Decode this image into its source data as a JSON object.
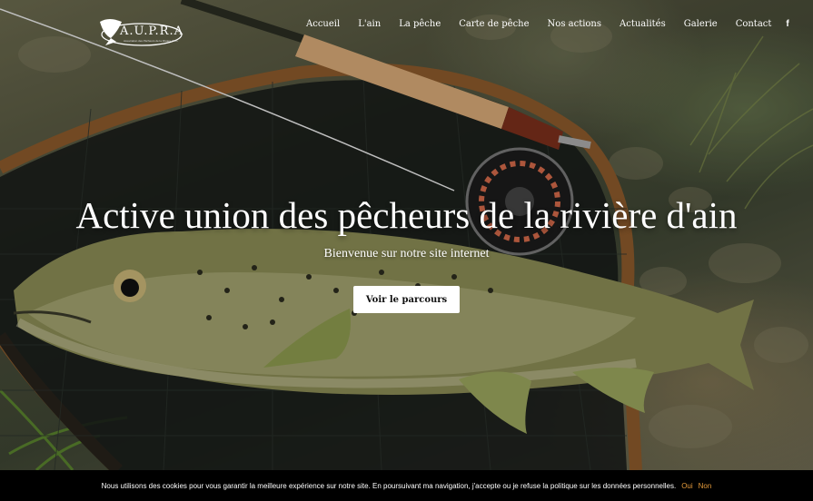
{
  "brand": {
    "logo_text": "A.U.P.R.A",
    "logo_subtext": "Association des Pêcheurs de la Rivière d'Ain"
  },
  "nav": {
    "items": [
      "Accueil",
      "L'ain",
      "La pêche",
      "Carte de pêche",
      "Nos actions",
      "Actualités",
      "Galerie",
      "Contact"
    ],
    "facebook": "f"
  },
  "hero": {
    "title": "Active union des pêcheurs de la rivière d'ain",
    "subtitle": "Bienvenue sur notre site internet",
    "cta_label": "Voir le parcours"
  },
  "cookie_bar": {
    "text": "Nous utilisons des cookies pour vous garantir la meilleure expérience sur notre site. En poursuivant ma navigation, j'accepte ou je refuse la politique sur les données personnelles.",
    "accept": "Oui",
    "refuse": "Non",
    "accent_color": "#e39a3b"
  }
}
